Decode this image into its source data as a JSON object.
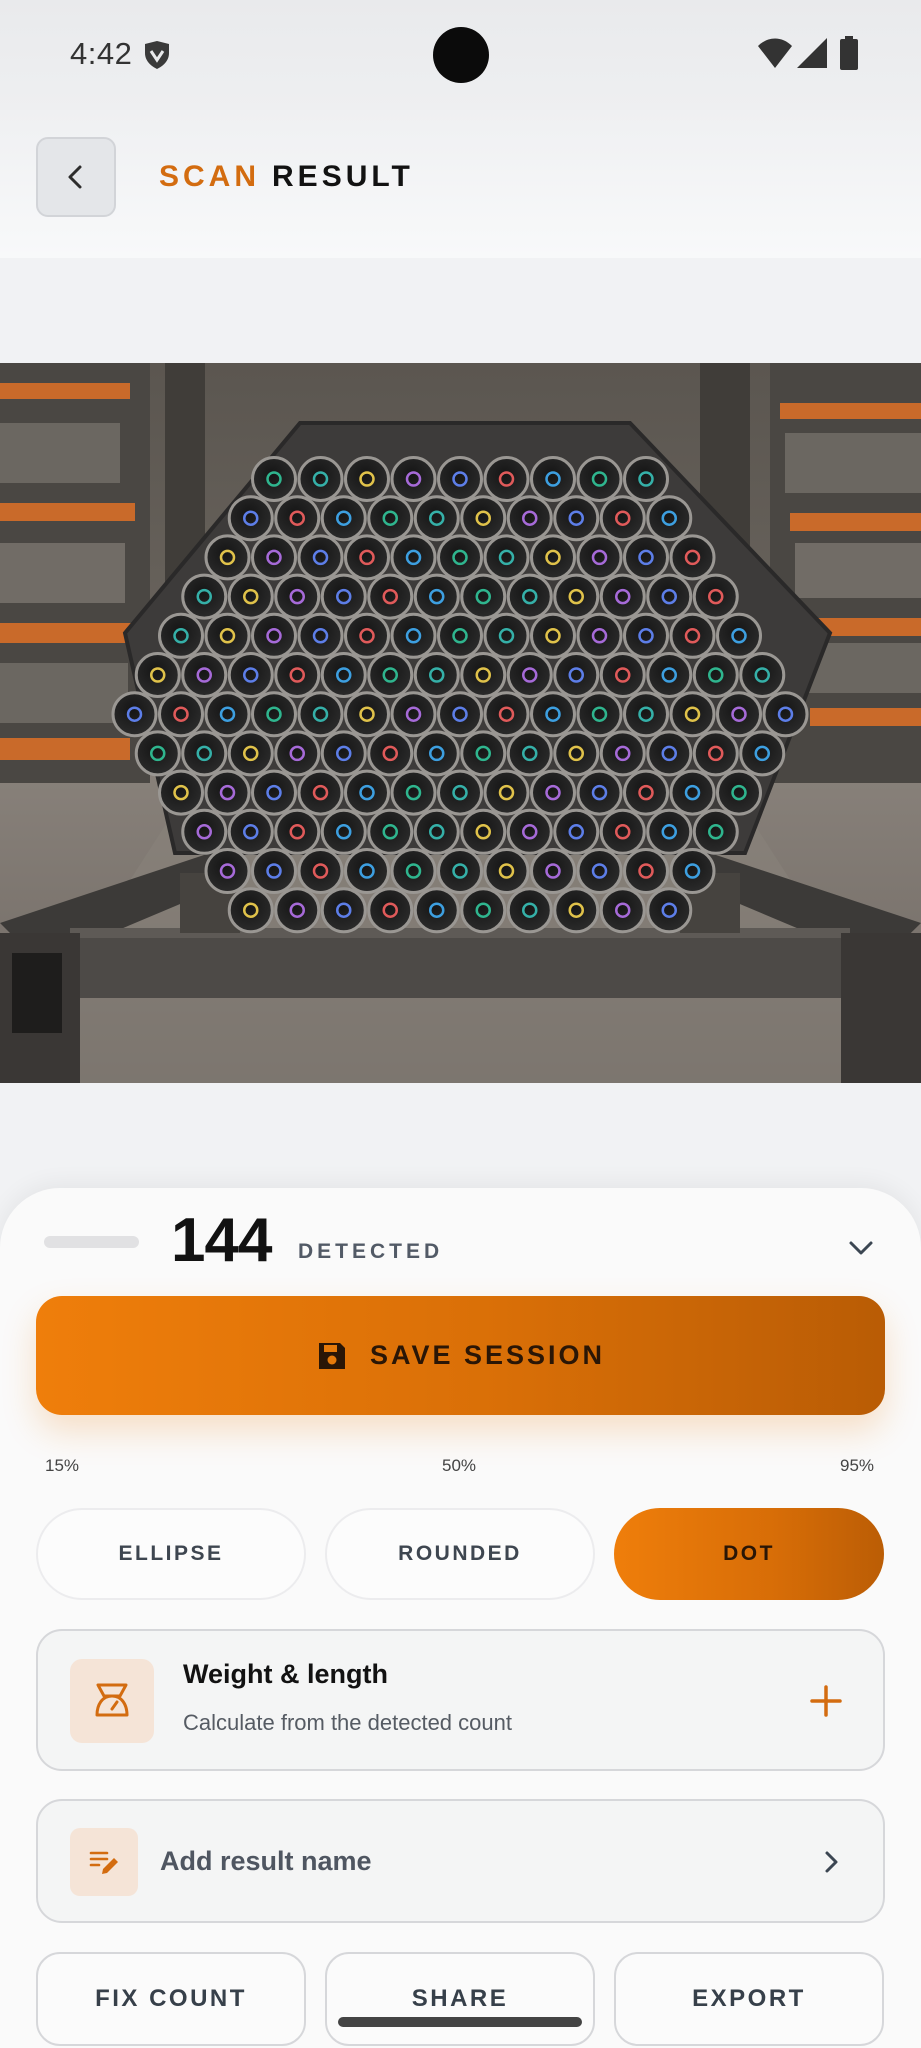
{
  "status_bar": {
    "time": "4:42"
  },
  "header": {
    "title_accent": "SCAN",
    "title_main": "RESULT",
    "back_icon": "chevron-left-icon"
  },
  "result": {
    "count": "144",
    "count_label": "DETECTED"
  },
  "save_button": {
    "label": "SAVE SESSION",
    "icon": "floppy-disk-icon"
  },
  "threshold_slider": {
    "min_label": "15%",
    "mid_label": "50%",
    "max_label": "95%"
  },
  "marker_shapes": {
    "options": [
      "ELLIPSE",
      "ROUNDED",
      "DOT"
    ],
    "selected": "DOT"
  },
  "weight_card": {
    "title": "Weight & length",
    "subtitle": "Calculate from the detected count",
    "icon": "scale-icon",
    "action_icon": "plus-icon"
  },
  "name_card": {
    "label": "Add result name",
    "icon": "edit-note-icon",
    "action_icon": "chevron-right-icon"
  },
  "actions": {
    "fix_count": "FIX COUNT",
    "share": "SHARE",
    "export": "EXPORT"
  },
  "colors": {
    "accent": "#EF7E0B",
    "accent_dark": "#B95C05",
    "background": "#F1F2F4",
    "card": "#F4F5F5"
  }
}
